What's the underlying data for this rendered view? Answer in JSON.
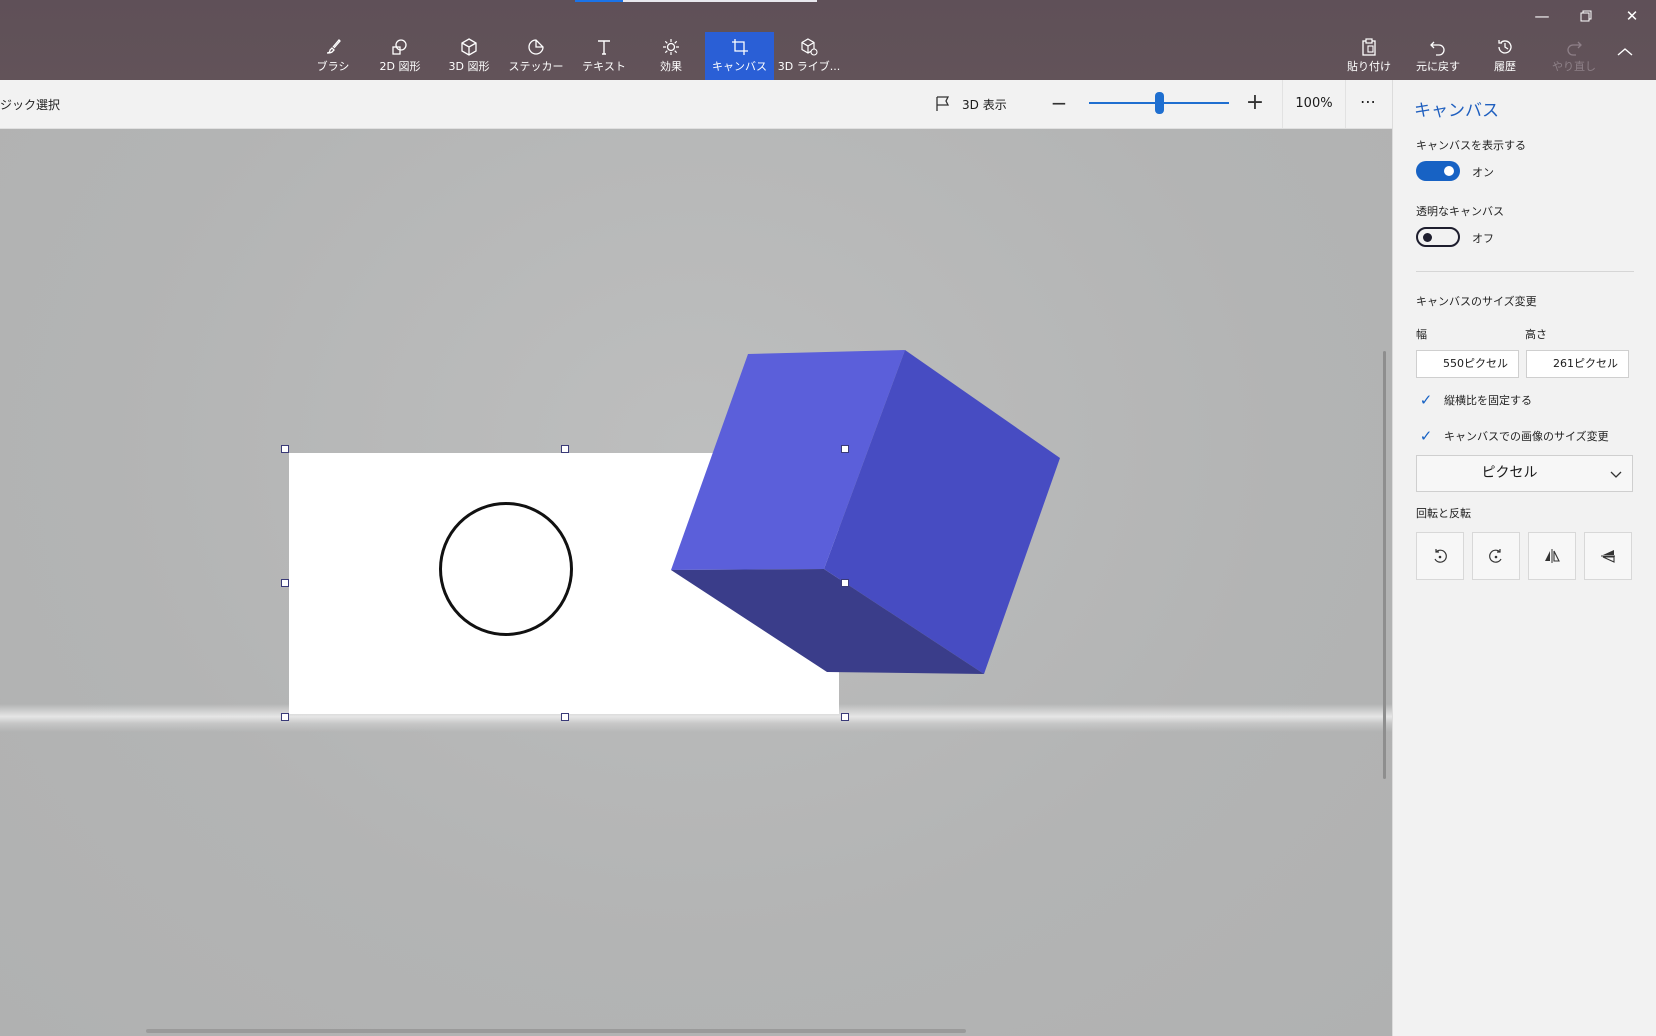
{
  "toolbar": {
    "tools": [
      {
        "label": "ブラシ",
        "icon": "brush-icon"
      },
      {
        "label": "2D 図形",
        "icon": "shapes-2d-icon"
      },
      {
        "label": "3D 図形",
        "icon": "cube-3d-icon"
      },
      {
        "label": "ステッカー",
        "icon": "sticker-icon"
      },
      {
        "label": "テキスト",
        "icon": "text-icon"
      },
      {
        "label": "効果",
        "icon": "effects-icon"
      },
      {
        "label": "キャンバス",
        "icon": "canvas-crop-icon",
        "active": true
      },
      {
        "label": "3D ライブ...",
        "icon": "library-3d-icon"
      }
    ],
    "right_tools": [
      {
        "label": "貼り付け",
        "icon": "paste-icon"
      },
      {
        "label": "元に戻す",
        "icon": "undo-icon"
      },
      {
        "label": "履歴",
        "icon": "history-icon"
      },
      {
        "label": "やり直し",
        "icon": "redo-icon",
        "disabled": true
      }
    ]
  },
  "subbar": {
    "magic_select": "マジック選択",
    "view_3d": "3D 表示",
    "zoom_percent": "100%",
    "zoom_level": 0.5
  },
  "panel": {
    "title": "キャンバス",
    "show_canvas": {
      "label": "キャンバスを表示する",
      "state": "オン",
      "on": true
    },
    "transparent": {
      "label": "透明なキャンバス",
      "state": "オフ",
      "on": false
    },
    "resize_heading": "キャンバスのサイズ変更",
    "width_label": "幅",
    "height_label": "高さ",
    "width_value": "550ピクセル",
    "height_value": "261ピクセル",
    "lock_aspect": {
      "label": "縦横比を固定する",
      "checked": true
    },
    "resize_image": {
      "label": "キャンバスでの画像のサイズ変更",
      "checked": true
    },
    "unit": "ピクセル",
    "rotate_heading": "回転と反転",
    "rotate_buttons": [
      "rotate-left-icon",
      "rotate-right-icon",
      "flip-horizontal-icon",
      "flip-vertical-icon"
    ]
  },
  "colors": {
    "accent": "#1762c4",
    "active_tool": "#2a5fd6",
    "cube_front": "#5b5fda",
    "cube_right": "#474cc2",
    "cube_bottom": "#3a3d8a"
  }
}
